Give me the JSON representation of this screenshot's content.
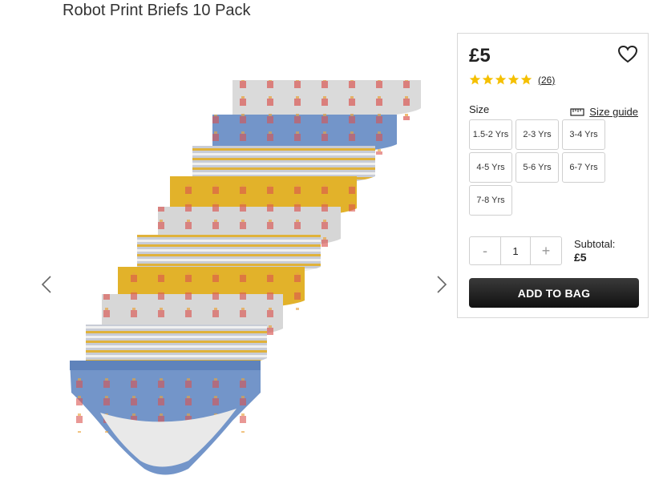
{
  "product": {
    "title": "Robot Print Briefs 10 Pack",
    "price": "£5",
    "review_count": "(26)",
    "rating": 5
  },
  "sizes": {
    "label": "Size",
    "guide_label": "Size guide",
    "options": [
      "1.5-2 Yrs",
      "2-3 Yrs",
      "3-4 Yrs",
      "4-5 Yrs",
      "5-6 Yrs",
      "6-7 Yrs",
      "7-8 Yrs"
    ]
  },
  "quantity": {
    "minus": "-",
    "value": "1",
    "plus": "+"
  },
  "subtotal": {
    "label": "Subtotal:",
    "amount": "£5"
  },
  "actions": {
    "add_to_bag": "ADD TO BAG"
  },
  "colors": {
    "star": "#f5c000",
    "button_dark": "#1a1a1a",
    "brief_grey": "#d9d9d9",
    "brief_blue": "#6f93c8",
    "brief_mustard": "#e2b22a",
    "brief_stripe_grey": "#bfc4cf"
  },
  "icons": {
    "prev": "chevron-left-icon",
    "next": "chevron-right-icon",
    "wishlist": "heart-icon",
    "star": "star-icon",
    "size_guide": "ruler-icon"
  }
}
